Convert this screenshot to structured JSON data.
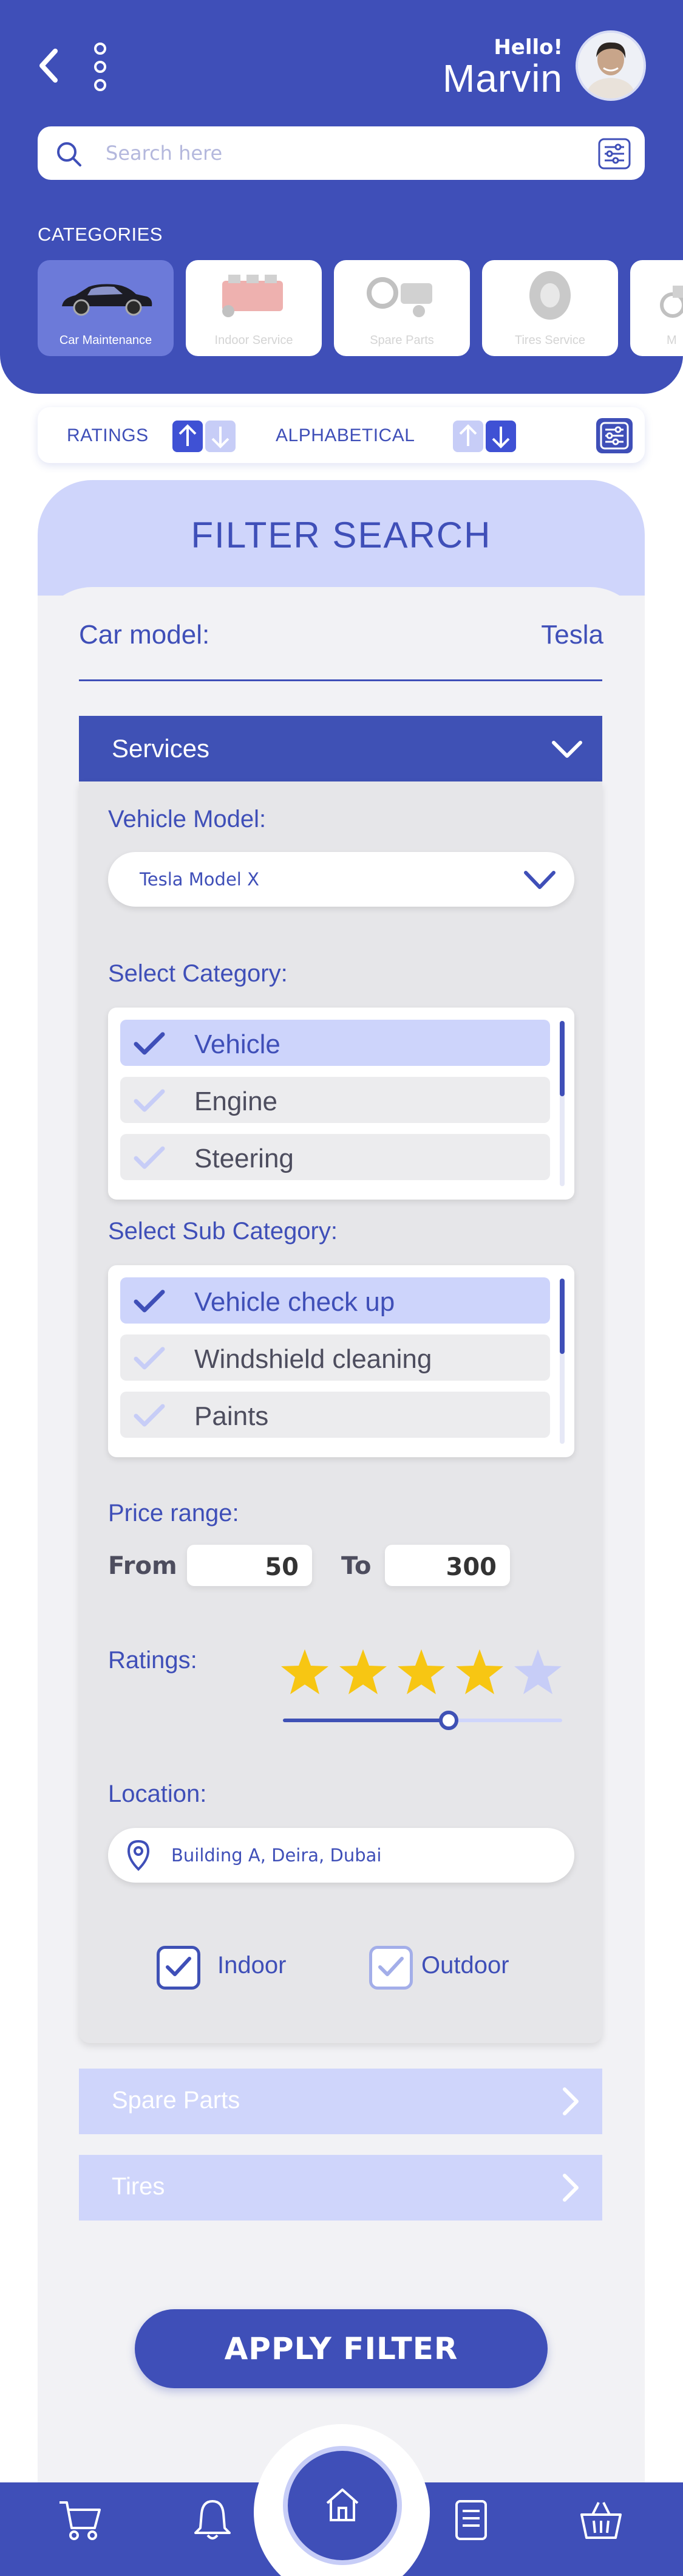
{
  "header": {
    "greeting": "Hello!",
    "user_name": "Marvin",
    "search_placeholder": "Search here"
  },
  "categories": {
    "title": "CATEGORIES",
    "items": [
      {
        "label": "Car Maintenance",
        "active": true,
        "icon": "car-icon"
      },
      {
        "label": "Indoor Service",
        "active": false,
        "icon": "engine-icon"
      },
      {
        "label": "Spare Parts",
        "active": false,
        "icon": "spare-parts-icon"
      },
      {
        "label": "Tires Service",
        "active": false,
        "icon": "tire-icon"
      },
      {
        "label": "M",
        "active": false,
        "icon": "atv-icon"
      }
    ]
  },
  "sortbar": {
    "ratings_label": "RATINGS",
    "alphabetical_label": "ALPHABETICAL"
  },
  "filter": {
    "title": "FILTER SEARCH",
    "car_model_label": "Car model:",
    "car_model_value": "Tesla",
    "services": {
      "title": "Services",
      "vehicle_model_label": "Vehicle Model:",
      "vehicle_model_value": "Tesla Model X",
      "select_category_label": "Select Category:",
      "categories": [
        {
          "label": "Vehicle",
          "selected": true
        },
        {
          "label": "Engine",
          "selected": false
        },
        {
          "label": "Steering",
          "selected": false
        }
      ],
      "select_subcategory_label": "Select Sub Category:",
      "subcategories": [
        {
          "label": "Vehicle check up",
          "selected": true
        },
        {
          "label": "Windshield cleaning",
          "selected": false
        },
        {
          "label": "Paints",
          "selected": false
        }
      ],
      "price_range_label": "Price range:",
      "from_label": "From",
      "from_value": "50",
      "to_label": "To",
      "to_value": "300",
      "ratings_label": "Ratings:",
      "rating_value": 4,
      "rating_max": 5,
      "location_label": "Location:",
      "location_value": "Building A, Deira, Dubai",
      "indoor_label": "Indoor",
      "indoor_checked": true,
      "outdoor_label": "Outdoor",
      "outdoor_checked": false
    },
    "spare_parts_label": "Spare Parts",
    "tires_label": "Tires"
  },
  "apply_button": "APPLY FILTER",
  "bottom_nav": {
    "items": [
      "cart-icon",
      "bell-icon",
      "home-icon",
      "document-icon",
      "basket-icon"
    ]
  },
  "colors": {
    "primary": "#3f4fb8",
    "light": "#cfd5fb",
    "star": "#f7c613",
    "star_empty": "#c7cdf7"
  }
}
